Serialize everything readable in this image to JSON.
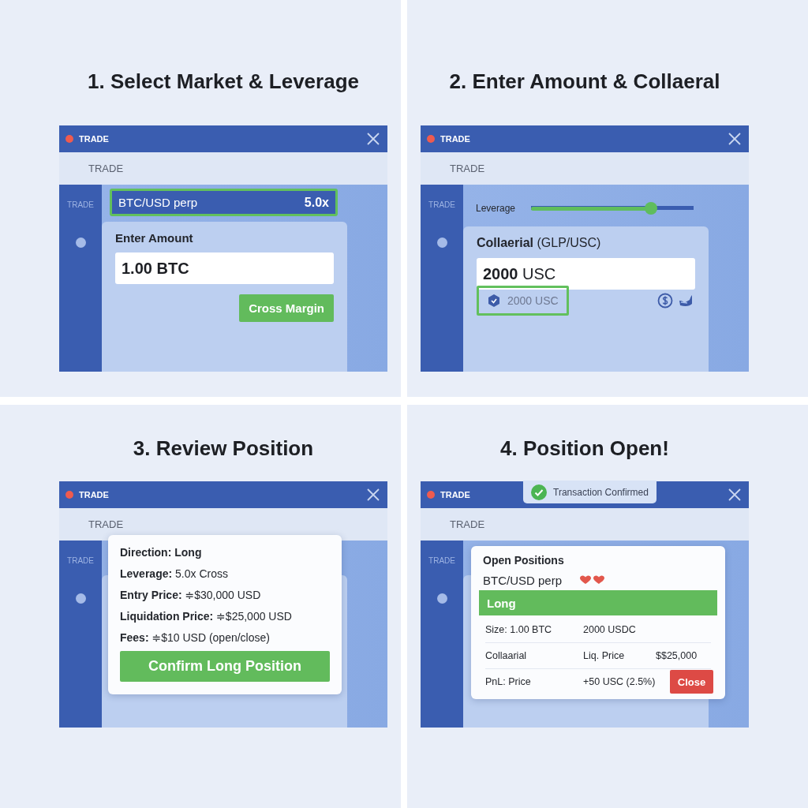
{
  "panels": [
    {
      "kind": "market",
      "heading": "1. Select Market & Leverage",
      "window": {
        "title": "TRADE",
        "tab": "TRADE",
        "sidebar_label": "TRADE"
      },
      "market": {
        "name": "BTC/USD perp",
        "leverage": "5.0x",
        "selected": true
      },
      "amount": {
        "label": "Enter Amount",
        "value": "1.00 BTC"
      },
      "margin_button": "Cross Margin"
    },
    {
      "kind": "collateral",
      "heading": "2. Enter Amount & Collaeral",
      "window": {
        "title": "TRADE",
        "tab": "TRADE",
        "sidebar_label": "TRADE"
      },
      "leverage": {
        "label": "Leverage",
        "level": 0.74
      },
      "collateral": {
        "label": "**Collaerial** (GLP/USC)",
        "value": "**2000** USC",
        "balance": {
          "value": "2000 USC",
          "selected": true
        }
      }
    },
    {
      "kind": "review",
      "heading": "3. Review Position",
      "window": {
        "title": "TRADE",
        "tab": "TRADE",
        "sidebar_label": "TRADE"
      },
      "direction": "Direction: Long",
      "details": [
        "**Leverage:** 5.0x Cross",
        "**Entry Price:** ≑$30,000 USD",
        "**Liquidation Price:** ≑$25,000 USD",
        "**Fees:** ≑$10 USD (open/close)"
      ],
      "confirm_button": "Confirm Long Position"
    },
    {
      "kind": "open",
      "heading": "4. Position Open!",
      "window": {
        "title": "TRADE",
        "tab": "TRADE",
        "sidebar_label": "TRADE"
      },
      "toast": "Transaction Confirmed",
      "positions": {
        "title": "Open Positions",
        "market": "BTC/USD perp",
        "side": "Long",
        "rows": [
          [
            "Size: 1.00 BTC",
            "2000 USDC"
          ],
          [
            "Collaarial",
            "Liq. Price",
            "$$25,000"
          ],
          [
            "PnL: Price",
            "+50 USC (2.5%)"
          ]
        ],
        "close_button": "Close"
      }
    }
  ]
}
